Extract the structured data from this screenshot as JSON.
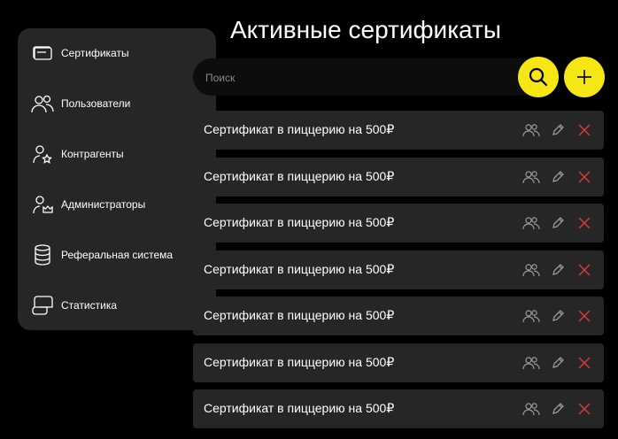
{
  "page": {
    "title": "Активные сертификаты"
  },
  "sidebar": {
    "items": [
      {
        "label": "Сертификаты",
        "icon": "certificate-icon"
      },
      {
        "label": "Пользователи",
        "icon": "users-icon"
      },
      {
        "label": "Контрагенты",
        "icon": "counterparty-icon"
      },
      {
        "label": "Администраторы",
        "icon": "admin-icon"
      },
      {
        "label": "Реферальная система",
        "icon": "database-icon"
      },
      {
        "label": "Статистика",
        "icon": "statistics-icon"
      }
    ]
  },
  "search": {
    "placeholder": "Поиск",
    "value": ""
  },
  "certificates": [
    {
      "title": "Сертификат в пиццерию на 500₽"
    },
    {
      "title": "Сертификат в пиццерию на 500₽"
    },
    {
      "title": "Сертификат в пиццерию на 500₽"
    },
    {
      "title": "Сертификат в пиццерию на 500₽"
    },
    {
      "title": "Сертификат в пиццерию на 500₽"
    },
    {
      "title": "Сертификат в пиццерию на 500₽"
    },
    {
      "title": "Сертификат в пиццерию на 500₽"
    }
  ],
  "colors": {
    "accent": "#f5e614",
    "background": "#000000",
    "panel": "#262626",
    "delete": "#d83a3a",
    "icon_muted": "#9a9a9a"
  }
}
